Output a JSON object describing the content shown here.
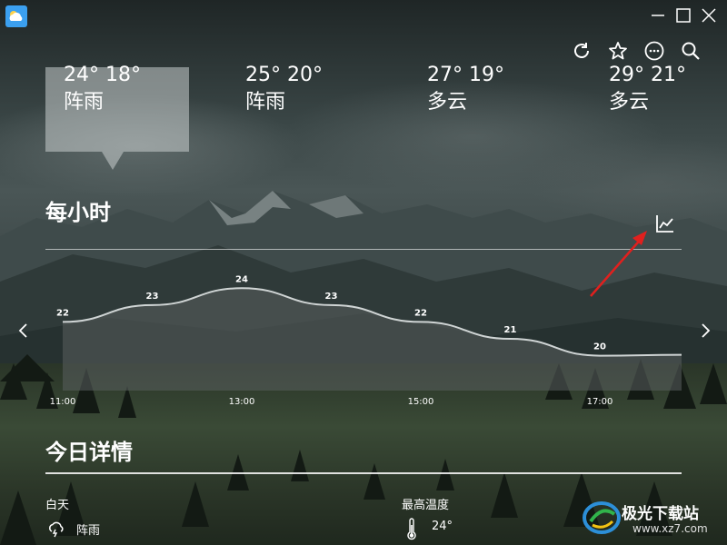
{
  "colors": {
    "accent": "#3ba0f0",
    "chart_line": "#cfd4d4",
    "chart_fill": "rgba(90,95,95,0.55)",
    "annotation_arrow": "#e0201e"
  },
  "titlebar": {
    "app_icon": "weather-app-icon",
    "buttons": [
      "minimize-icon",
      "maximize-icon",
      "close-icon"
    ]
  },
  "toolbar": {
    "icons": [
      "refresh-icon",
      "star-icon",
      "more-icon",
      "search-icon"
    ]
  },
  "daily": [
    {
      "temps": "24° 18°",
      "condition": "阵雨"
    },
    {
      "temps": "25° 20°",
      "condition": "阵雨"
    },
    {
      "temps": "27° 19°",
      "condition": "多云"
    },
    {
      "temps": "29° 21°",
      "condition": "多云"
    }
  ],
  "hourly": {
    "title": "每小时",
    "toggle_icon": "line-chart-icon"
  },
  "chart_data": {
    "type": "line",
    "points": [
      {
        "label": "22",
        "value": 22
      },
      {
        "label": "23",
        "value": 23
      },
      {
        "label": "24",
        "value": 24
      },
      {
        "label": "23",
        "value": 23
      },
      {
        "label": "22",
        "value": 22
      },
      {
        "label": "21",
        "value": 21
      },
      {
        "label": "20",
        "value": 20
      }
    ],
    "x_labels": [
      "11:00",
      "13:00",
      "15:00",
      "17:00"
    ],
    "ylim": [
      17.5,
      24.5
    ]
  },
  "nav": {
    "left_icon": "chevron-left-icon",
    "right_icon": "chevron-right-icon"
  },
  "today": {
    "title": "今日详情",
    "daytime_label": "白天",
    "daytime_value": "阵雨",
    "daytime_icon": "shower-icon",
    "max_temp_label": "最高温度",
    "max_temp_value": "24°",
    "max_temp_icon": "thermometer-icon"
  },
  "watermark": {
    "name": "极光下载站",
    "url": "www.xz7.com",
    "icon": "watermark-logo-icon"
  }
}
